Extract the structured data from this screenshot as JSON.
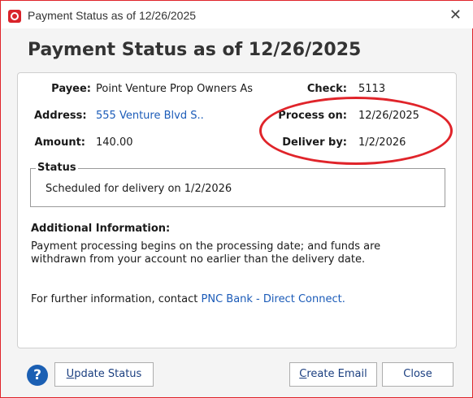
{
  "window": {
    "title": "Payment Status as of 12/26/2025",
    "close_glyph": "✕",
    "app_icon": "quicken-app-icon"
  },
  "heading": "Payment Status as of 12/26/2025",
  "details": {
    "payee_label": "Payee:",
    "payee_value": "Point Venture Prop Owners As",
    "address_label": "Address:",
    "address_value": "555 Venture Blvd S..",
    "amount_label": "Amount:",
    "amount_value": "140.00",
    "check_label": "Check:",
    "check_value": "5113",
    "process_label": "Process on:",
    "process_value": "12/26/2025",
    "deliver_label": "Deliver by:",
    "deliver_value": "1/2/2026"
  },
  "status": {
    "legend": "Status",
    "text": "Scheduled for delivery on 1/2/2026"
  },
  "additional": {
    "title": "Additional Information:",
    "text": "Payment processing begins on the processing date; and funds are withdrawn from your account no earlier than the delivery date.",
    "contact_prefix": "For further information, contact",
    "contact_link": "PNC Bank - Direct Connect."
  },
  "buttons": {
    "help": "?",
    "update_first": "U",
    "update_rest": "pdate Status",
    "email_first": "C",
    "email_rest": "reate Email",
    "close": "Close"
  },
  "colors": {
    "accent_red": "#e0242a",
    "link_blue": "#1b5bb8",
    "help_blue": "#1b5fb3"
  }
}
